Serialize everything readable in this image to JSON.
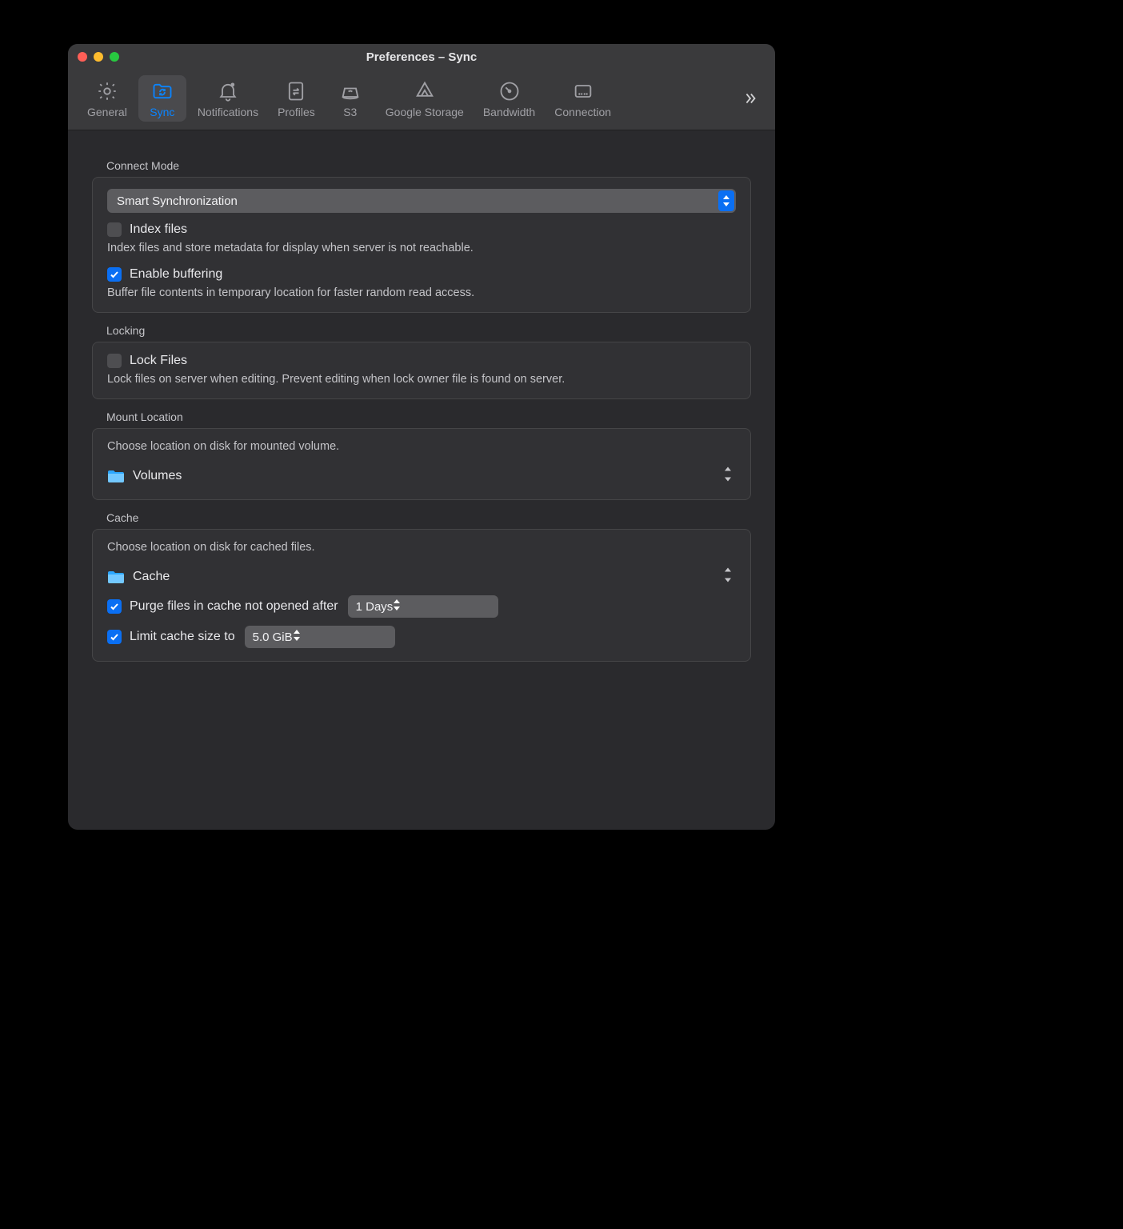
{
  "window": {
    "title": "Preferences – Sync"
  },
  "toolbar": {
    "items": [
      {
        "label": "General"
      },
      {
        "label": "Sync"
      },
      {
        "label": "Notifications"
      },
      {
        "label": "Profiles"
      },
      {
        "label": "S3"
      },
      {
        "label": "Google Storage"
      },
      {
        "label": "Bandwidth"
      },
      {
        "label": "Connection"
      }
    ],
    "active_index": 1
  },
  "sections": {
    "connect_mode": {
      "title": "Connect Mode",
      "mode_select": "Smart Synchronization",
      "index_files": {
        "label": "Index files",
        "checked": false,
        "desc": "Index files and store metadata for display when server is not reachable."
      },
      "buffering": {
        "label": "Enable buffering",
        "checked": true,
        "desc": "Buffer file contents in temporary location for faster random read access."
      }
    },
    "locking": {
      "title": "Locking",
      "lock_files": {
        "label": "Lock Files",
        "checked": false,
        "desc": "Lock files on server when editing. Prevent editing when lock owner file is found on server."
      }
    },
    "mount": {
      "title": "Mount Location",
      "desc": "Choose location on disk for mounted volume.",
      "folder": "Volumes"
    },
    "cache": {
      "title": "Cache",
      "desc": "Choose location on disk for cached files.",
      "folder": "Cache",
      "purge": {
        "label": "Purge files in cache not opened after",
        "checked": true,
        "value": "1 Days"
      },
      "limit": {
        "label": "Limit cache size to",
        "checked": true,
        "value": "5.0 GiB"
      }
    }
  }
}
